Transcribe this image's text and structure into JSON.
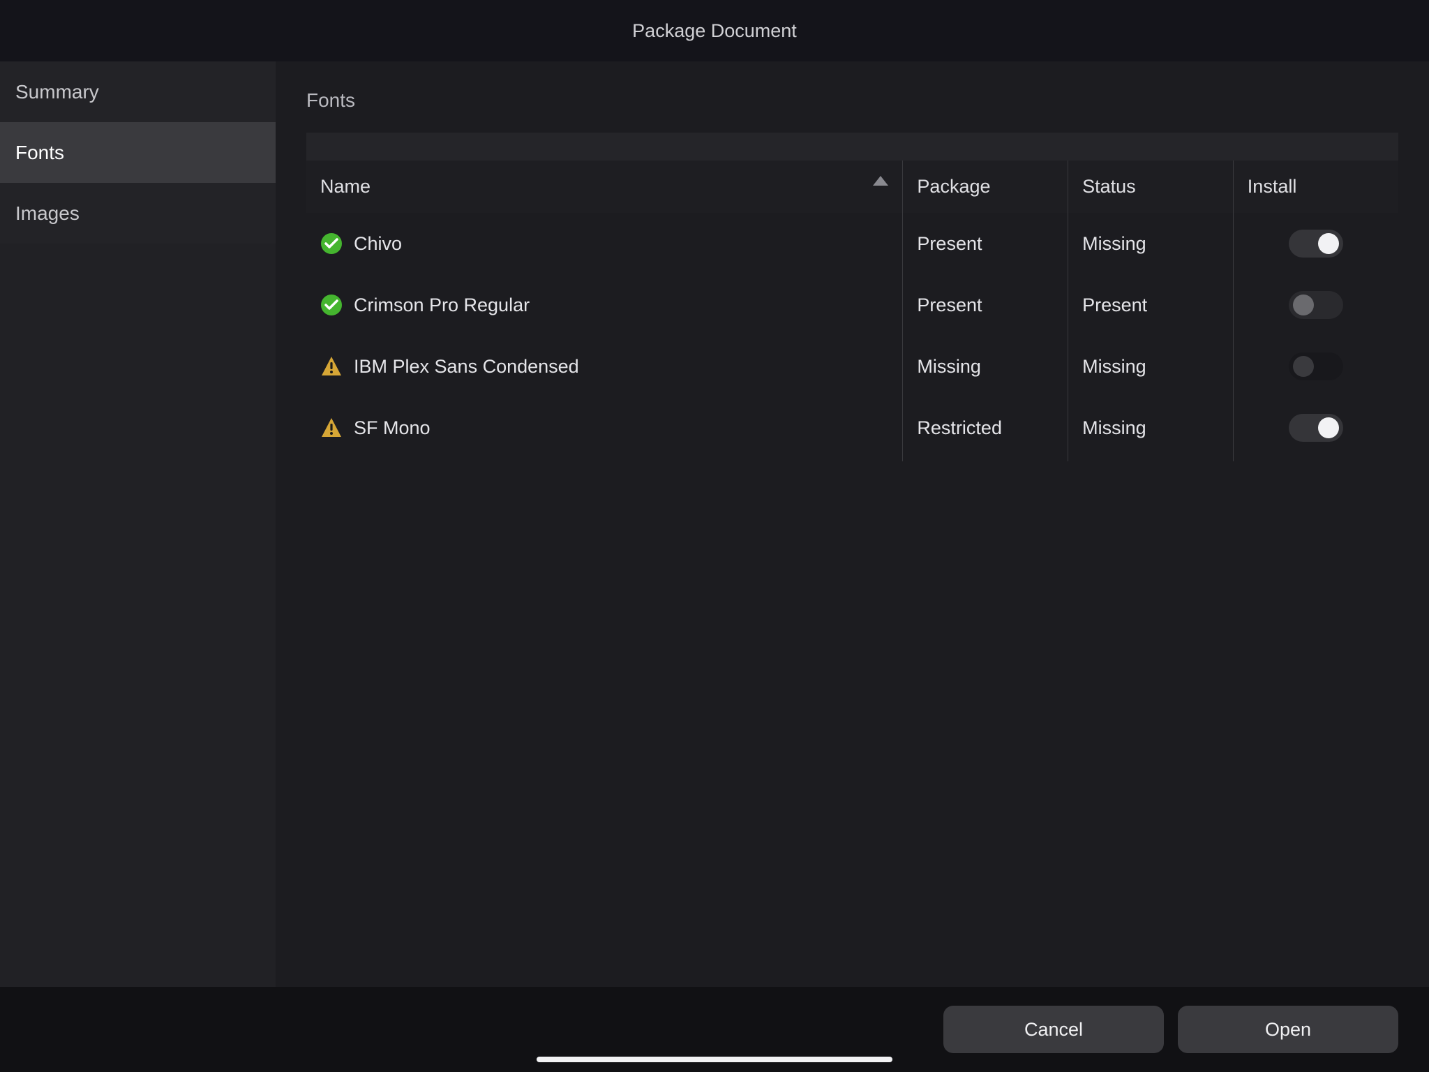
{
  "title": "Package Document",
  "sidebar": {
    "items": [
      {
        "label": "Summary",
        "selected": false
      },
      {
        "label": "Fonts",
        "selected": true
      },
      {
        "label": "Images",
        "selected": false
      }
    ]
  },
  "main": {
    "section_title": "Fonts",
    "columns": {
      "name": "Name",
      "package": "Package",
      "status": "Status",
      "install": "Install"
    },
    "sort_column": "name",
    "sort_dir": "asc",
    "rows": [
      {
        "icon": "check",
        "name": "Chivo",
        "package": "Present",
        "status": "Missing",
        "install_on": true,
        "install_enabled": true
      },
      {
        "icon": "check",
        "name": "Crimson Pro Regular",
        "package": "Present",
        "status": "Present",
        "install_on": false,
        "install_enabled": false
      },
      {
        "icon": "warning",
        "name": "IBM Plex Sans Condensed",
        "package": "Missing",
        "status": "Missing",
        "install_on": false,
        "install_enabled": true
      },
      {
        "icon": "warning",
        "name": "SF Mono",
        "package": "Restricted",
        "status": "Missing",
        "install_on": true,
        "install_enabled": true
      }
    ]
  },
  "footer": {
    "cancel": "Cancel",
    "open": "Open"
  }
}
